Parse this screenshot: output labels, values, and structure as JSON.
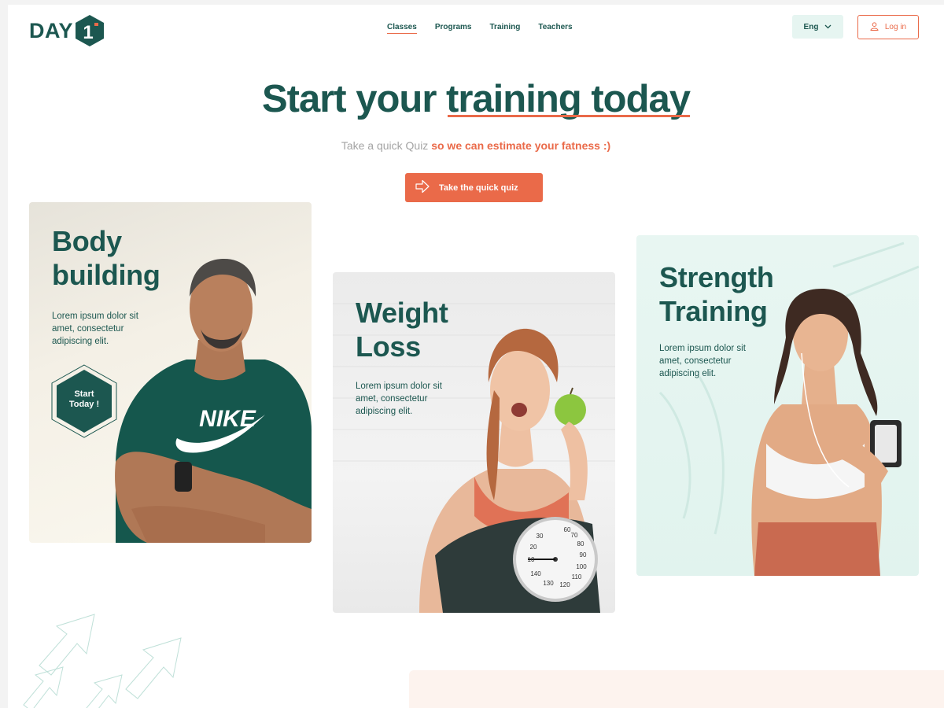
{
  "header": {
    "logo_text": "DAY",
    "logo_badge": "1",
    "nav": [
      {
        "label": "Classes",
        "active": true
      },
      {
        "label": "Programs",
        "active": false
      },
      {
        "label": "Training",
        "active": false
      },
      {
        "label": "Teachers",
        "active": false
      }
    ],
    "language": "Eng",
    "login_label": "Log in"
  },
  "hero": {
    "title_start": "Start your ",
    "title_highlight": "training today",
    "subtitle_plain": "Take a quick Quiz ",
    "subtitle_accent": "so we can estimate your fatness :)",
    "cta_label": "Take the quick quiz"
  },
  "cards": [
    {
      "title_line1": "Body",
      "title_line2": "building",
      "description": "Lorem ipsum dolor sit amet, consectetur adipiscing elit.",
      "button_line1": "Start",
      "button_line2": "Today !",
      "shirt_text": "NIKE"
    },
    {
      "title_line1": "Weight",
      "title_line2": "Loss",
      "description": "Lorem ipsum dolor sit amet, consectetur adipiscing elit.",
      "scale_numbers": [
        "10",
        "20",
        "30",
        "60",
        "70",
        "80",
        "90",
        "100",
        "110",
        "120",
        "130",
        "140"
      ]
    },
    {
      "title_line1": "Strength",
      "title_line2": "Training",
      "description": "Lorem ipsum dolor sit amet, consectetur adipiscing elit."
    }
  ],
  "colors": {
    "primary": "#1c5750",
    "accent": "#ea6a49",
    "lang_bg": "#e6f5f1",
    "strength_bg": "#e1f3ee"
  },
  "icons": {
    "cta": "arrow-right-outline-icon",
    "login": "user-icon",
    "lang": "chevron-down-icon"
  }
}
